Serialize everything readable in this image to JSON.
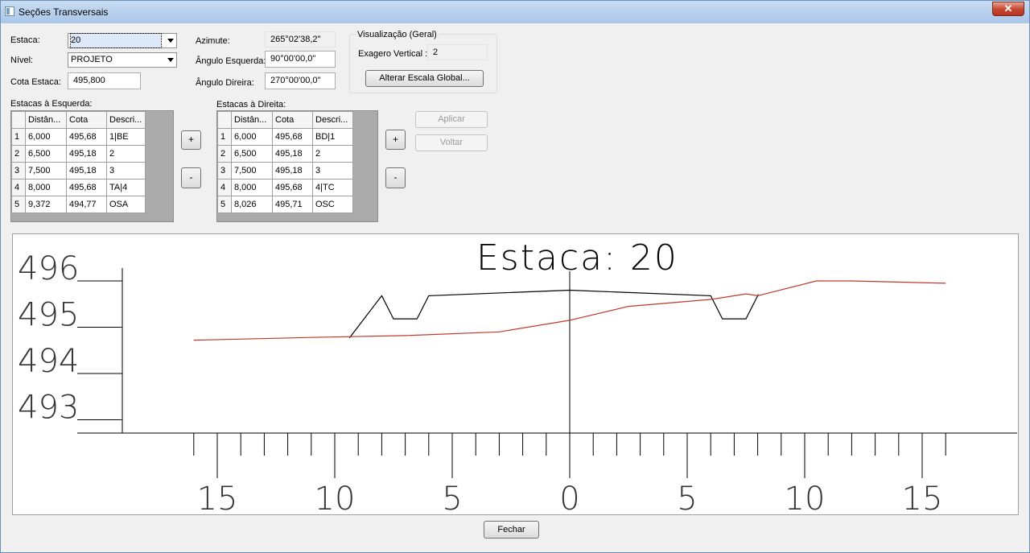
{
  "window": {
    "title": "Seções Transversais",
    "close_icon": "close-icon"
  },
  "form": {
    "estaca_label": "Estaca:",
    "estaca_value": "20",
    "nivel_label": "Nível:",
    "nivel_value": "PROJETO",
    "cota_estaca_label": "Cota Estaca:",
    "cota_estaca_value": "495,800",
    "azimute_label": "Azimute:",
    "azimute_value": "265°02'38,2\"",
    "angulo_esquerda_label": "Ângulo Esquerda:",
    "angulo_esquerda_value": "90°00'00,0\"",
    "angulo_direita_label": "Ângulo Direira:",
    "angulo_direita_value": "270°00'00,0\""
  },
  "visualizacao": {
    "group_title": "Visualização (Geral)",
    "exagero_label": "Exagero Vertical :",
    "exagero_value": "2",
    "alterar_button": "Alterar Escala Global..."
  },
  "left_table": {
    "caption": "Estacas à Esquerda:",
    "headers": [
      "Distân...",
      "Cota",
      "Descri..."
    ],
    "rows": [
      {
        "n": "1",
        "dist": "6,000",
        "cota": "495,68",
        "desc": "1|BE"
      },
      {
        "n": "2",
        "dist": "6,500",
        "cota": "495,18",
        "desc": "2"
      },
      {
        "n": "3",
        "dist": "7,500",
        "cota": "495,18",
        "desc": "3"
      },
      {
        "n": "4",
        "dist": "8,000",
        "cota": "495,68",
        "desc": "TA|4"
      },
      {
        "n": "5",
        "dist": "9,372",
        "cota": "494,77",
        "desc": "OSA"
      }
    ],
    "add_label": "+",
    "remove_label": "-"
  },
  "right_table": {
    "caption": "Estacas à Direita:",
    "headers": [
      "Distân...",
      "Cota",
      "Descri..."
    ],
    "rows": [
      {
        "n": "1",
        "dist": "6,000",
        "cota": "495,68",
        "desc": "BD|1"
      },
      {
        "n": "2",
        "dist": "6,500",
        "cota": "495,18",
        "desc": "2"
      },
      {
        "n": "3",
        "dist": "7,500",
        "cota": "495,18",
        "desc": "3"
      },
      {
        "n": "4",
        "dist": "8,000",
        "cota": "495,68",
        "desc": "4|TC"
      },
      {
        "n": "5",
        "dist": "8,026",
        "cota": "495,71",
        "desc": "OSC"
      }
    ],
    "add_label": "+",
    "remove_label": "-"
  },
  "actions": {
    "aplicar": "Aplicar",
    "voltar": "Voltar",
    "fechar": "Fechar"
  },
  "chart_data": {
    "type": "line",
    "title": "Estaca: 20",
    "xlabel": "",
    "ylabel": "",
    "xlim": [
      -16,
      16
    ],
    "ylim": [
      493,
      496.3
    ],
    "x_ticks": [
      -15,
      -10,
      -5,
      0,
      5,
      10,
      15
    ],
    "x_tick_labels": [
      "15",
      "10",
      "5",
      "0",
      "5",
      "10",
      "15"
    ],
    "y_ticks": [
      496,
      495,
      494,
      493
    ],
    "y_tick_labels": [
      "496",
      "495",
      "494",
      "493"
    ],
    "grid": false,
    "legend": "none",
    "series": [
      {
        "color": "#000000",
        "x": [
          -9.372,
          -8.0,
          -7.5,
          -6.5,
          -6.0,
          0,
          6.0,
          6.5,
          7.5,
          8.0,
          8.026
        ],
        "y": [
          494.77,
          495.68,
          495.18,
          495.18,
          495.68,
          495.8,
          495.68,
          495.18,
          495.18,
          495.68,
          495.71
        ]
      },
      {
        "color": "#c0392b",
        "x": [
          -16,
          -11,
          -7,
          -3,
          0,
          2.5,
          6,
          7.5,
          8.0,
          10.5,
          12,
          16
        ],
        "y": [
          494.72,
          494.78,
          494.82,
          494.9,
          495.15,
          495.45,
          495.6,
          495.72,
          495.68,
          496.0,
          496.0,
          495.95
        ]
      }
    ]
  }
}
